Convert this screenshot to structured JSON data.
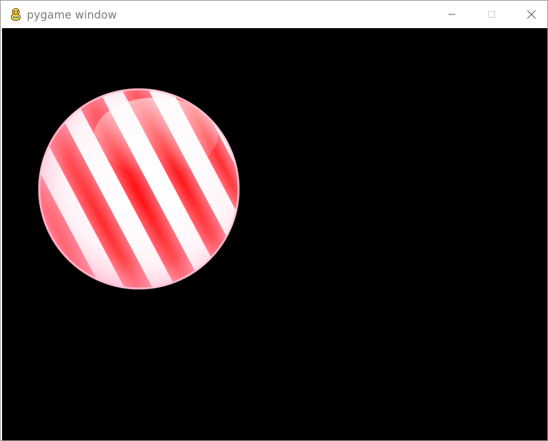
{
  "window": {
    "title": "pygame window",
    "app_icon": "pygame-snake-icon",
    "controls": {
      "minimize_icon": "minimize-icon",
      "maximize_icon": "maximize-icon",
      "close_icon": "close-icon"
    }
  },
  "canvas": {
    "background": "#000000",
    "sprite": {
      "kind": "striped-ball-sprite",
      "stripe_color": "#ff1a1a",
      "base_color": "#ffffff"
    }
  }
}
